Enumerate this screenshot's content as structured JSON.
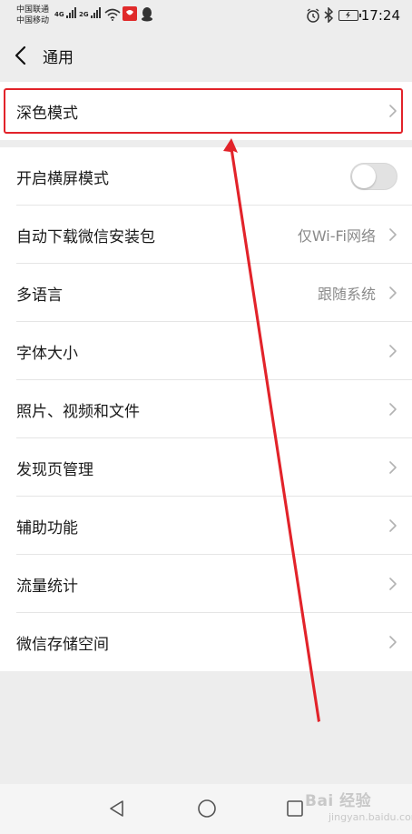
{
  "status_bar": {
    "carrier_1": "中国联通",
    "carrier_2": "中国移动",
    "network_1": "4G",
    "network_2": "2G",
    "time": "17:24",
    "icons": [
      "wifi-icon",
      "app-notification-icon",
      "qq-icon",
      "alarm-icon",
      "bluetooth-icon",
      "battery-icon"
    ]
  },
  "header": {
    "title": "通用",
    "back_icon": "chevron-left-icon"
  },
  "dark_mode": {
    "label": "深色模式"
  },
  "settings": {
    "landscape": {
      "label": "开启横屏模式",
      "enabled": false
    },
    "items": [
      {
        "label": "自动下载微信安装包",
        "value": "仅Wi-Fi网络"
      },
      {
        "label": "多语言",
        "value": "跟随系统"
      },
      {
        "label": "字体大小",
        "value": ""
      },
      {
        "label": "照片、视频和文件",
        "value": ""
      },
      {
        "label": "发现页管理",
        "value": ""
      },
      {
        "label": "辅助功能",
        "value": ""
      },
      {
        "label": "流量统计",
        "value": ""
      },
      {
        "label": "微信存储空间",
        "value": ""
      }
    ]
  },
  "annotation": {
    "color": "#e2232a"
  },
  "nav_bar": {
    "icons": [
      "back-triangle-icon",
      "home-circle-icon",
      "recents-square-icon"
    ]
  },
  "watermark": {
    "text": "Bai 经验",
    "sub": "jingyan.baidu.com"
  }
}
